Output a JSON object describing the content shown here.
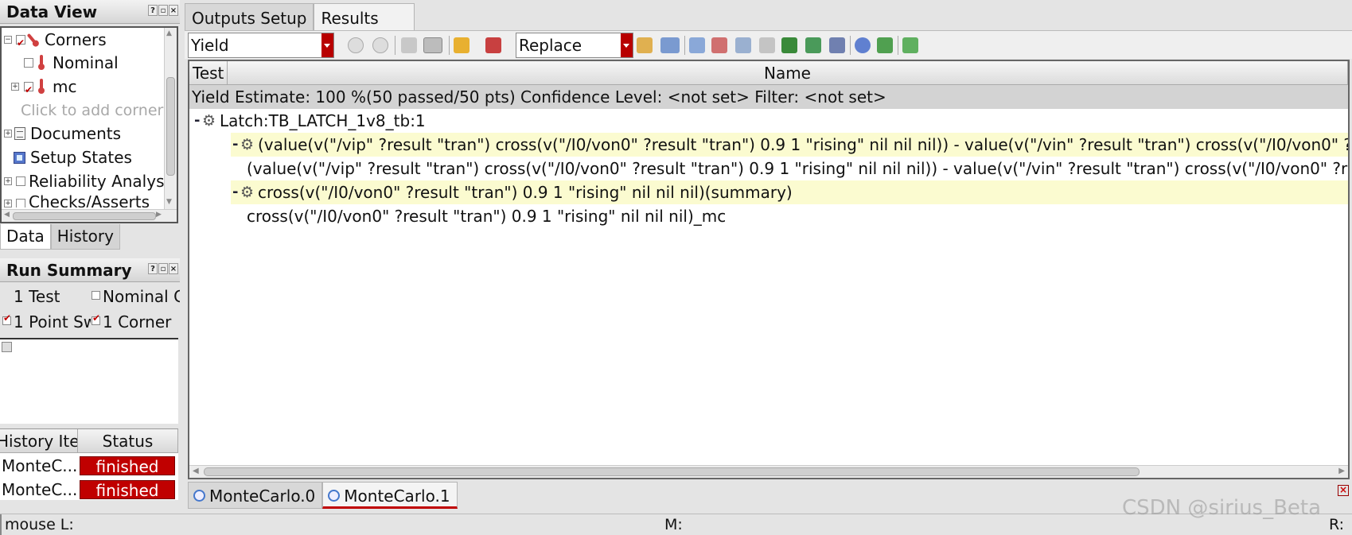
{
  "data_view": {
    "title": "Data View",
    "tree": {
      "corners": "Corners",
      "nominal": "Nominal",
      "mc": "mc",
      "add_corner": "Click to add corner",
      "documents": "Documents",
      "setup_states": "Setup States",
      "reliability": "Reliability Analyses",
      "checks": "Checks/Asserts"
    },
    "tabs": [
      "Data",
      "History"
    ]
  },
  "run_summary": {
    "title": "Run Summary",
    "test": "1 Test",
    "nominal_corner": "Nominal C",
    "point_sweep": "1 Point Sw",
    "corner": "1 Corner"
  },
  "history": {
    "col_item": "History Item",
    "col_status": "Status",
    "rows": [
      {
        "item": "MonteC...",
        "status": "finished"
      },
      {
        "item": "MonteC...",
        "status": "finished"
      }
    ]
  },
  "main": {
    "tabs": [
      "Outputs Setup",
      "Results"
    ],
    "toolbar": {
      "view_combo": "Yield",
      "mode_combo": "Replace"
    },
    "results": {
      "col_test": "Test",
      "col_name": "Name",
      "yield_line": "Yield Estimate: 100 %(50 passed/50 pts)    Confidence Level: <not set>   Filter: <not set>",
      "group": "Latch:TB_LATCH_1v8_tb:1",
      "row1": "(value(v(\"/vip\" ?result \"tran\") cross(v(\"/I0/von0\" ?result \"tran\") 0.9 1 \"rising\" nil nil nil)) - value(v(\"/vin\" ?result \"tran\") cross(v(\"/I0/von0\" ?result \"tran\") 0.9 1 \"rising\" nil nil nil)))(summary)",
      "row2": "(value(v(\"/vip\" ?result \"tran\") cross(v(\"/I0/von0\" ?result \"tran\") 0.9 1 \"rising\" nil nil nil)) - value(v(\"/vin\" ?result \"tran\") cross(v(\"/I0/von0\" ?result \"tran\") 0.9 1 \"rising\" nil nil nil)))_mc",
      "row3": "cross(v(\"/I0/von0\" ?result \"tran\") 0.9 1 \"rising\" nil nil nil)(summary)",
      "row4": "cross(v(\"/I0/von0\" ?result \"tran\") 0.9 1 \"rising\" nil nil nil)_mc"
    },
    "bottom_tabs": [
      "MonteCarlo.0",
      "MonteCarlo.1"
    ]
  },
  "statusbar": {
    "left": "mouse L:",
    "middle": "M:",
    "right": "R:"
  },
  "watermark": "CSDN @sirius_Beta",
  "colors": {
    "accent_red": "#c00000",
    "highlight_row": "#fbfbd0",
    "yield_bar": "#d3d3d3"
  }
}
